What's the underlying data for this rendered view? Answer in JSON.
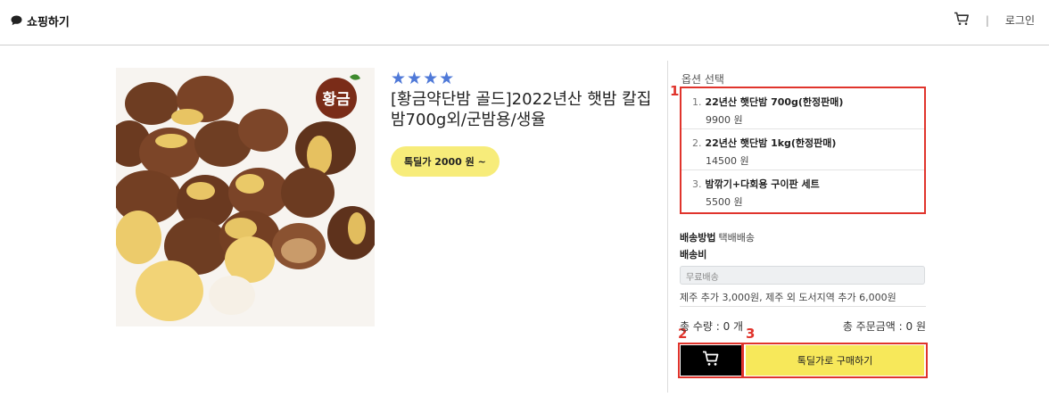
{
  "header": {
    "brand_label": "쇼핑하기",
    "cart_icon": "cart-icon",
    "separator": "|",
    "login_label": "로그인"
  },
  "product": {
    "rating_stars": "★★★★",
    "rating": 4,
    "title": "[황금약단밤 골드]2022년산 햇밤 칼집밤700g외/군밤용/생율",
    "deal_button": "톡딜가 2000 원 ~",
    "image_logo_text": "황금"
  },
  "options": {
    "label": "옵션 선택",
    "items": [
      {
        "num": "1.",
        "name": "22년산 햇단밤 700g(한정판매)",
        "price": "9900 원"
      },
      {
        "num": "2.",
        "name": "22년산 햇단밤 1kg(한정판매)",
        "price": "14500 원"
      },
      {
        "num": "3.",
        "name": "밤깎기+다회용 구이판 세트",
        "price": "5500 원"
      }
    ]
  },
  "shipping": {
    "method_title": "배송방법",
    "method_value": "택배배송",
    "fee_title": "배송비",
    "fee_value": "무료배송",
    "note": "제주 추가 3,000원, 제주 외 도서지역 추가 6,000원"
  },
  "totals": {
    "quantity": "총 수량 : 0 개",
    "amount": "총 주문금액 : 0 원"
  },
  "actions": {
    "buy_label": "톡딜가로 구매하기"
  },
  "annotations": {
    "a1": "1",
    "a2": "2",
    "a3": "3",
    "color": "#e0342c"
  },
  "colors": {
    "star": "#4f79d8",
    "deal": "#f7ec7a",
    "buy": "#f7e85a"
  }
}
